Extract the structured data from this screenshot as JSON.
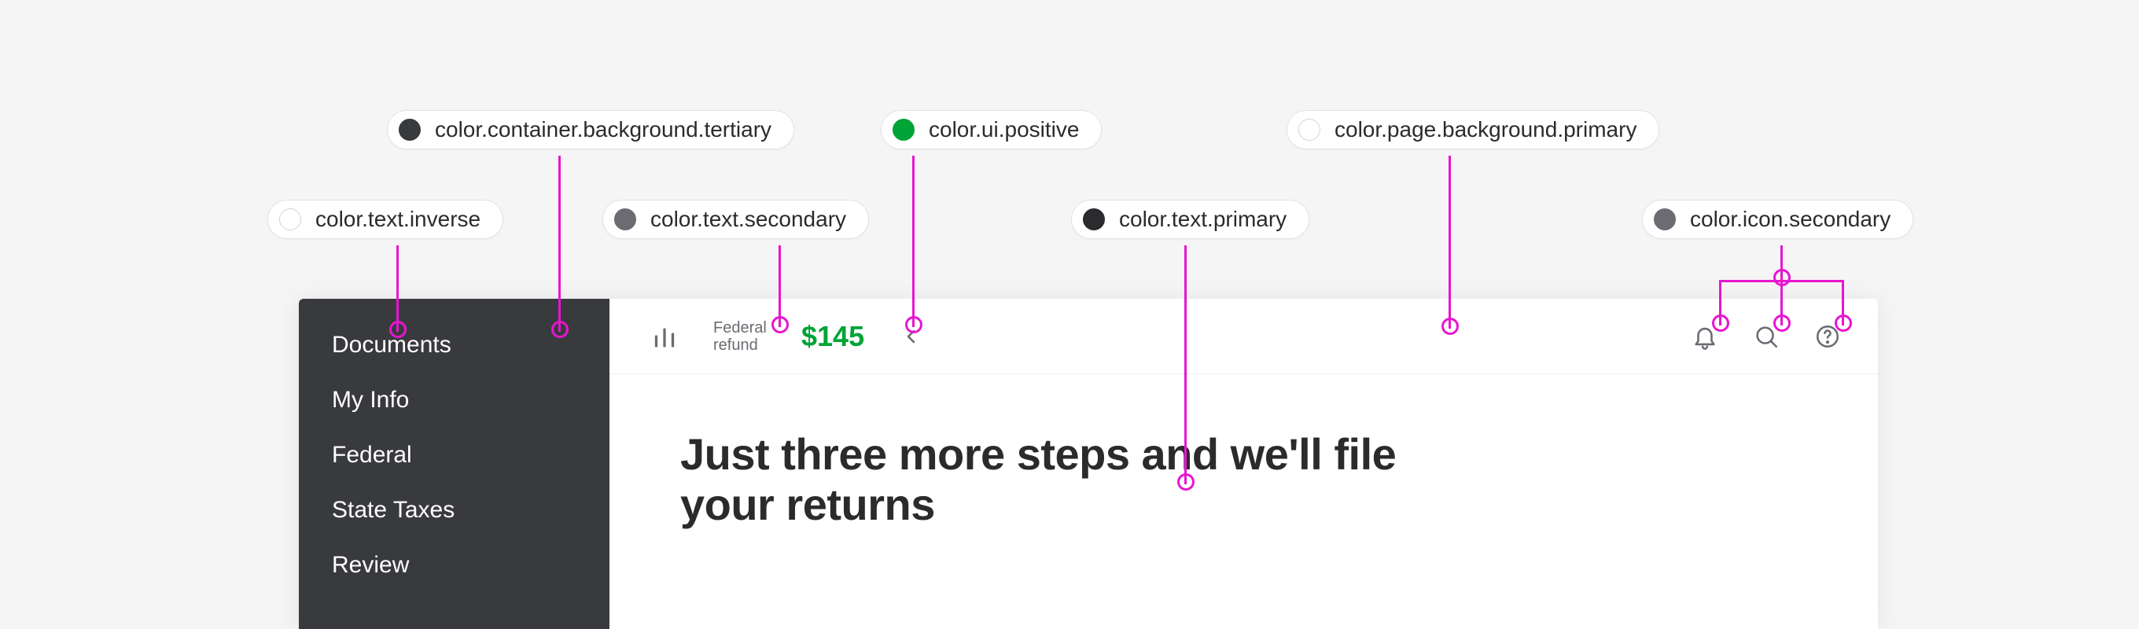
{
  "annotations": {
    "text_inverse": {
      "label": "color.text.inverse",
      "swatch": "#ffffff"
    },
    "container_bg": {
      "label": "color.container.background.tertiary",
      "swatch": "#393a3d"
    },
    "text_secondary": {
      "label": "color.text.secondary",
      "swatch": "#6b6c72"
    },
    "ui_positive": {
      "label": "color.ui.positive",
      "swatch": "#00a336"
    },
    "text_primary": {
      "label": "color.text.primary",
      "swatch": "#2b2b2e"
    },
    "page_bg_primary": {
      "label": "color.page.background.primary",
      "swatch": "#ffffff"
    },
    "icon_secondary": {
      "label": "color.icon.secondary",
      "swatch": "#6b6c72"
    }
  },
  "sidebar": {
    "items": [
      "Documents",
      "My Info",
      "Federal",
      "State Taxes",
      "Review"
    ]
  },
  "topbar": {
    "refund_label": "Federal refund",
    "refund_amount": "$145"
  },
  "main": {
    "heading": "Just three more steps and we'll file your returns"
  },
  "icons": {
    "chart": "chart-icon",
    "back": "chevron-left-icon",
    "bell": "bell-icon",
    "search": "search-icon",
    "help": "help-icon"
  }
}
